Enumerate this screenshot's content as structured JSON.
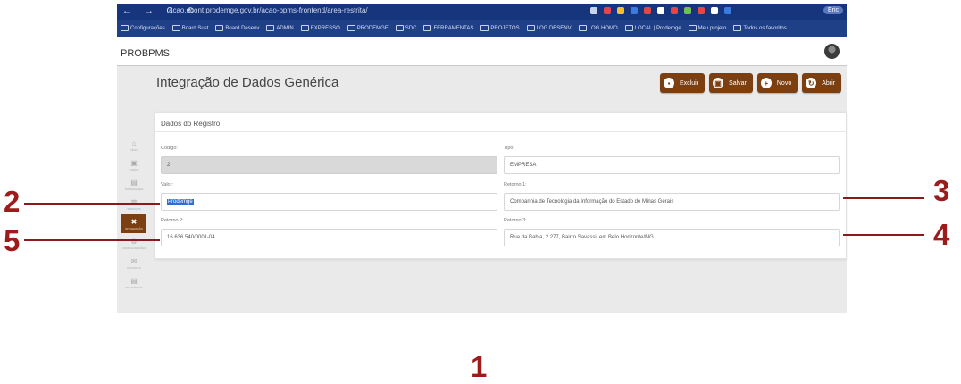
{
  "browser": {
    "nav": "← → C ⟲",
    "url": "acao.dcont.prodemge.gov.br/acao-bpms-frontend/area-restrita/",
    "profile": "Eric",
    "bookmarks": [
      "Configurações",
      "Board Sust",
      "Board Desenv",
      "ADMIN",
      "EXPRESSO",
      "PRODEMGE",
      "SDC",
      "FERRAMENTAS",
      "PROJETOS",
      "LOG DESENV",
      "LOG HOMO",
      "LOCAL | Prodemge",
      "Meu projeto",
      "Todos os favoritos"
    ],
    "tray_colors": [
      "#c9d3ec",
      "#e04848",
      "#f0c030",
      "#3a7be0",
      "#e04848",
      "#ffffff",
      "#e04848",
      "#6fbf5a",
      "#e04848",
      "#ffffff",
      "#3a7be0"
    ]
  },
  "app": {
    "name": "PROBPMS"
  },
  "sidebar": [
    {
      "icon": "⌂",
      "label": "INÍCIO"
    },
    {
      "icon": "▣",
      "label": "DADOS"
    },
    {
      "icon": "▤",
      "label": "TRANSAÇÕES"
    },
    {
      "icon": "▥",
      "label": "SERVIÇOS"
    },
    {
      "icon": "✖",
      "label": "INTEGRAÇÃO",
      "active": true
    },
    {
      "icon": "⚙",
      "label": "CONFIGURAÇÕES"
    },
    {
      "icon": "✉",
      "label": "MÉTRICAS"
    },
    {
      "icon": "▤",
      "label": "RELATÓRIOS"
    }
  ],
  "page": {
    "title": "Integração de Dados Genérica"
  },
  "toolbar": {
    "delete_label": "Excluir",
    "save_label": "Salvar",
    "new_label": "Novo",
    "open_label": "Abrir"
  },
  "form": {
    "section_title": "Dados do Registro",
    "codigo": {
      "label": "Código:",
      "value": "2"
    },
    "tipo": {
      "label": "Tipo:",
      "value": "EMPRESA"
    },
    "valor": {
      "label": "Valor:",
      "value": "Prodemge"
    },
    "retorno1": {
      "label": "Retorno 1:",
      "value": "Companhia de Tecnologia da Informação do Estado de Minas Gerais"
    },
    "retorno2": {
      "label": "Retorno 2:",
      "value": "16.636.540/0001-04"
    },
    "retorno3": {
      "label": "Retorno 3:",
      "value": "Rua da Bahia, 2.277, Bairro Savassi, em Belo Horizonte/MG"
    }
  },
  "callouts": {
    "n1": "1",
    "n2": "2",
    "n3": "3",
    "n4": "4",
    "n5": "5"
  },
  "colors": {
    "brand": "#7b3f12",
    "callout": "#9e1b1b",
    "browser": "#1f3f87"
  }
}
